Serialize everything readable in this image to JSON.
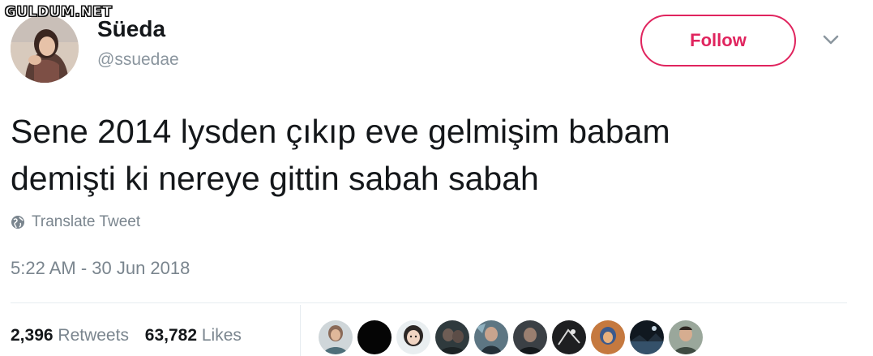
{
  "watermark": "GULDUM.NET",
  "user": {
    "display_name": "Süeda",
    "handle": "@ssuedae"
  },
  "follow_label": "Follow",
  "tweet": {
    "line1": "Sene 2014 lysden çıkıp eve gelmişim babam",
    "line2": "demişti ki nereye gittin sabah sabah"
  },
  "translate_label": "Translate Tweet",
  "timestamp": "5:22 AM - 30 Jun 2018",
  "stats": {
    "retweets_count": "2,396",
    "retweets_label": "Retweets",
    "likes_count": "63,782",
    "likes_label": "Likes"
  },
  "colors": {
    "follow_accent": "#e0245e",
    "text_primary": "#14171a",
    "text_secondary": "#7a858e"
  },
  "likers": [
    {
      "name": "liker-1"
    },
    {
      "name": "liker-2"
    },
    {
      "name": "liker-3"
    },
    {
      "name": "liker-4"
    },
    {
      "name": "liker-5"
    },
    {
      "name": "liker-6"
    },
    {
      "name": "liker-7"
    },
    {
      "name": "liker-8"
    },
    {
      "name": "liker-9"
    },
    {
      "name": "liker-10"
    }
  ]
}
